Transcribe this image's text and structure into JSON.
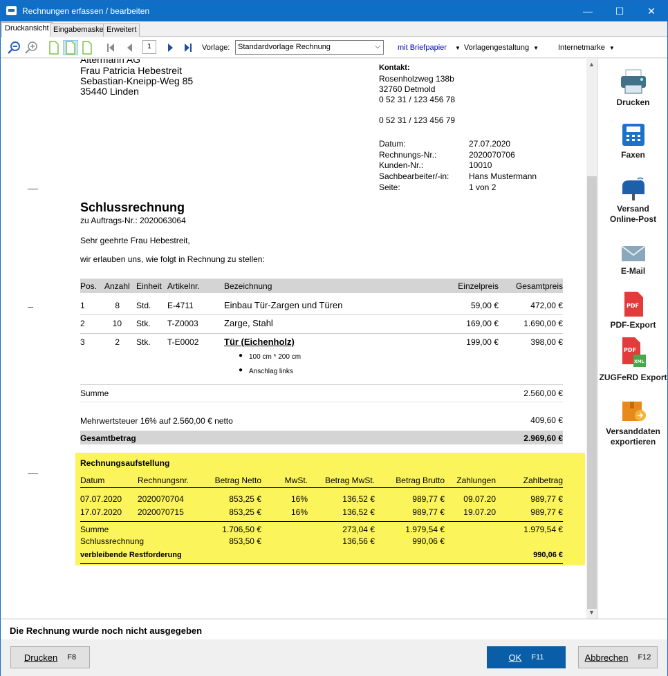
{
  "window": {
    "title": "Rechnungen erfassen / bearbeiten",
    "minimize": "—",
    "maximize": "☐",
    "close": "✕"
  },
  "tabs": [
    "Druckansicht",
    "Eingabemaske",
    "Erweitert"
  ],
  "toolbar": {
    "page_number": "1",
    "vorlage_label": "Vorlage:",
    "vorlage_value": "Standardvorlage Rechnung",
    "briefpapier": "mit Briefpapier",
    "vorlagengestaltung": "Vorlagengestaltung",
    "internetmarke": "Internetmarke"
  },
  "document": {
    "recipient": [
      "Altermann AG",
      "Frau Patricia Hebestreit",
      "Sebastian-Kneipp-Weg 85",
      "35440 Linden"
    ],
    "kontakt_label": "Kontakt:",
    "kontakt": [
      "Rosenholzweg 138b",
      "32760 Detmold",
      "0 52 31 / 123 456 78"
    ],
    "fax": "0 52 31 / 123 456 79",
    "info": [
      {
        "label": "Datum:",
        "value": "27.07.2020"
      },
      {
        "label": "Rechnungs-Nr.:",
        "value": "2020070706"
      },
      {
        "label": "Kunden-Nr.:",
        "value": "10010"
      },
      {
        "label": "Sachbearbeiter/-in:",
        "value": "Hans Mustermann"
      },
      {
        "label": "Seite:",
        "value": "1 von 2"
      }
    ],
    "heading": "Schlussrechnung",
    "subheading": "zu Auftrags-Nr.: 2020063064",
    "salutation": "Sehr geehrte Frau Hebestreit,",
    "intro": "wir erlauben uns, wie folgt in Rechnung zu stellen:",
    "columns": {
      "pos": "Pos.",
      "anzahl": "Anzahl",
      "einheit": "Einheit",
      "artikel": "Artikelnr.",
      "bezeichnung": "Bezeichnung",
      "einzelpreis": "Einzelpreis",
      "gesamtpreis": "Gesamtpreis"
    },
    "items": [
      {
        "pos": "1",
        "anzahl": "8",
        "einheit": "Std.",
        "artikel": "E-4711",
        "bezeichnung": "Einbau Tür-Zargen und Türen",
        "einzelpreis": "59,00 €",
        "gesamtpreis": "472,00 €"
      },
      {
        "pos": "2",
        "anzahl": "10",
        "einheit": "Stk.",
        "artikel": "T-Z0003",
        "bezeichnung": "Zarge, Stahl",
        "einzelpreis": "169,00 €",
        "gesamtpreis": "1.690,00 €"
      },
      {
        "pos": "3",
        "anzahl": "2",
        "einheit": "Stk.",
        "artikel": "T-E0002",
        "bezeichnung": "Tür (Eichenholz)",
        "einzelpreis": "199,00 €",
        "gesamtpreis": "398,00 €"
      }
    ],
    "item3_bullets": [
      "100 cm * 200 cm",
      "Anschlag links"
    ],
    "summe_label": "Summe",
    "summe_value": "2.560,00 €",
    "mwst_label": "Mehrwertsteuer 16% auf 2.560,00 € netto",
    "mwst_value": "409,60 €",
    "gesamt_label": "Gesamtbetrag",
    "gesamt_value": "2.969,60 €",
    "aufstellung": {
      "title": "Rechnungsaufstellung",
      "columns": [
        "Datum",
        "Rechnungsnr.",
        "Betrag Netto",
        "MwSt.",
        "Betrag MwSt.",
        "Betrag Brutto",
        "Zahlungen",
        "Zahlbetrag"
      ],
      "rows": [
        [
          "07.07.2020",
          "2020070704",
          "853,25 €",
          "16%",
          "136,52 €",
          "989,77 €",
          "09.07.20",
          "989,77 €"
        ],
        [
          "17.07.2020",
          "2020070715",
          "853,25 €",
          "16%",
          "136,52 €",
          "989,77 €",
          "19.07.20",
          "989,77 €"
        ]
      ],
      "summe": [
        "Summe",
        "",
        "1.706,50 €",
        "",
        "273,04 €",
        "1.979,54 €",
        "",
        "1.979,54 €"
      ],
      "schluss": [
        "Schlussrechnung",
        "",
        "853,50 €",
        "",
        "136,56 €",
        "990,06 €",
        "",
        ""
      ],
      "rest_label": "verbleibende Restforderung",
      "rest_value": "990,06 €"
    }
  },
  "sidepanel": [
    {
      "label": "Drucken",
      "icon": "printer-icon"
    },
    {
      "label": "Faxen",
      "icon": "fax-icon"
    },
    {
      "label": "Versand Online-Post",
      "icon": "mailbox-icon"
    },
    {
      "label": "E-Mail",
      "icon": "envelope-icon"
    },
    {
      "label": "PDF-Export",
      "icon": "pdf-icon"
    },
    {
      "label": "ZUGFeRD Export",
      "icon": "zugferd-icon"
    },
    {
      "label": "Versanddaten exportieren",
      "icon": "box-export-icon"
    }
  ],
  "status": "Die Rechnung wurde noch nicht ausgegeben",
  "buttons": {
    "drucken": "Drucken",
    "drucken_key": "F8",
    "ok": "OK",
    "ok_key": "F11",
    "abbrechen": "Abbrechen",
    "abbrechen_key": "F12"
  },
  "colors": {
    "titlebar": "#0f6ec6",
    "highlight": "#fcf45b",
    "primary_button": "#0a5ea8"
  }
}
